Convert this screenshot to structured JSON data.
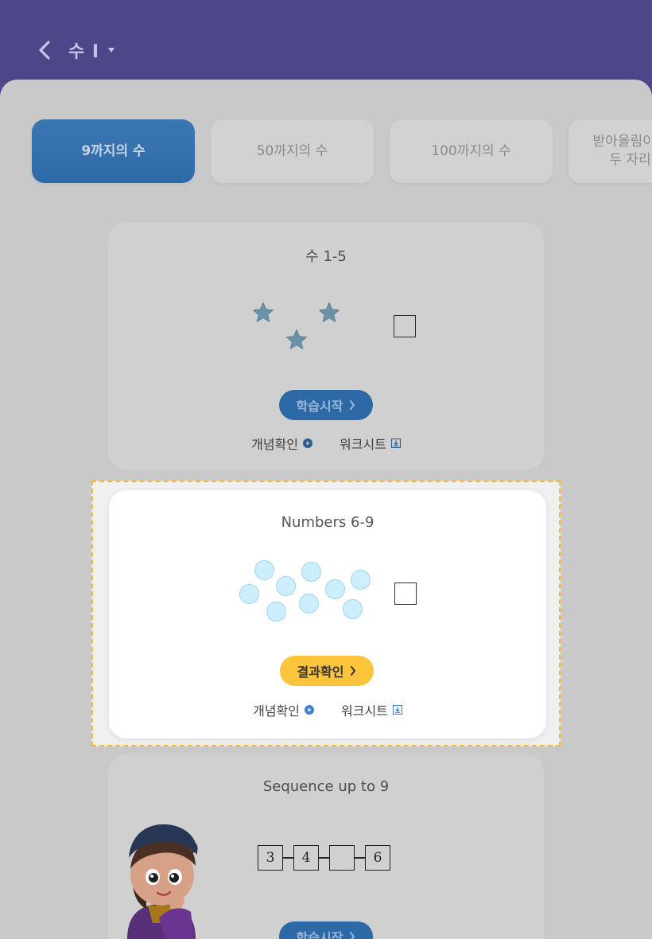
{
  "header": {
    "title": "수 I",
    "colors": {
      "background": "#4d4789",
      "text": "#c8c4e6"
    }
  },
  "tabs": [
    {
      "label": "9까지의 수",
      "active": true
    },
    {
      "label": "50까지의 수",
      "active": false
    },
    {
      "label": "100까지의 수",
      "active": false
    },
    {
      "label": "받아올림이 있는 두 자리 수",
      "active": false
    }
  ],
  "cards": [
    {
      "title": "수 1-5",
      "star_count": 3,
      "button_label": "학습시작",
      "links": [
        {
          "label": "개념확인",
          "icon": "play-icon"
        },
        {
          "label": "워크시트",
          "icon": "download-icon"
        }
      ]
    },
    {
      "title": "Numbers 6-9",
      "bubble_count": 9,
      "button_label": "결과확인",
      "highlighted": true,
      "links": [
        {
          "label": "개념확인",
          "icon": "play-icon"
        },
        {
          "label": "워크시트",
          "icon": "download-icon"
        }
      ]
    },
    {
      "title": "Sequence up to 9",
      "sequence": [
        "3",
        "4",
        "",
        "6"
      ],
      "button_label": "학습시작"
    }
  ],
  "colors": {
    "accent_blue": "#2d69a6",
    "accent_yellow": "#fcc43a",
    "highlight_border": "#f5b935",
    "bubble_fill": "#cdeefc"
  }
}
